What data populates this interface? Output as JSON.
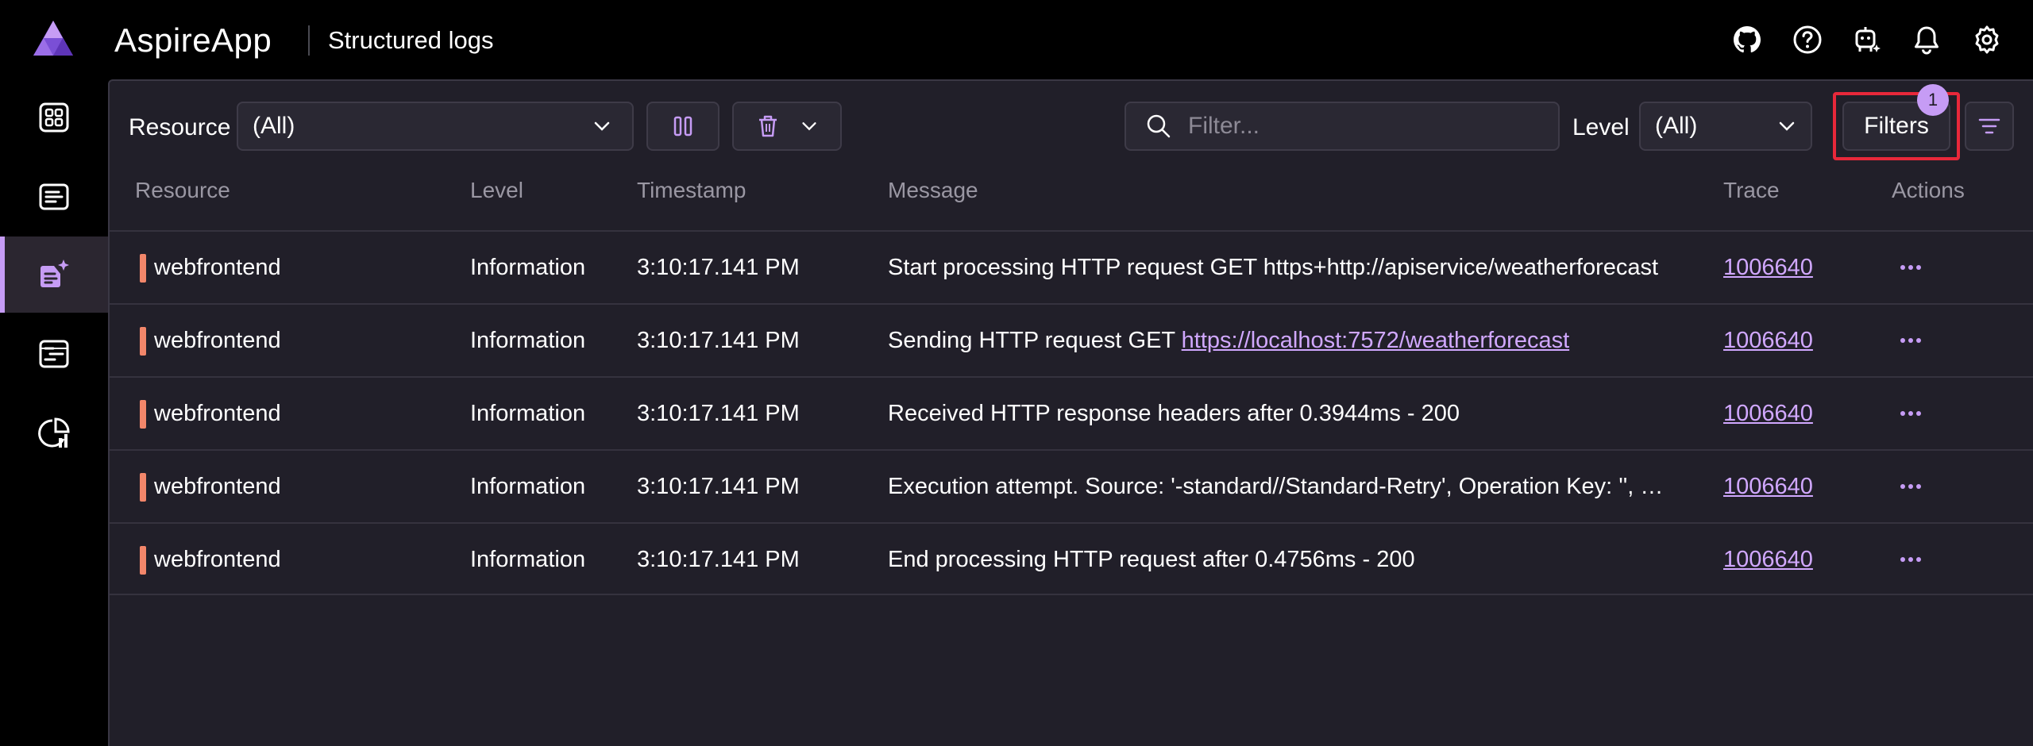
{
  "header": {
    "app_title": "AspireApp",
    "page_title": "Structured logs",
    "icons": [
      "github-icon",
      "help-icon",
      "copilot-icon",
      "notifications-icon",
      "settings-icon"
    ]
  },
  "sidenav": {
    "items": [
      {
        "name": "resources",
        "icon": "grid-icon",
        "active": false
      },
      {
        "name": "console",
        "icon": "console-icon",
        "active": false
      },
      {
        "name": "structured-logs",
        "icon": "structured-logs-icon",
        "active": true
      },
      {
        "name": "traces",
        "icon": "traces-icon",
        "active": false
      },
      {
        "name": "metrics",
        "icon": "metrics-icon",
        "active": false
      }
    ]
  },
  "toolbar": {
    "resource_label": "Resource",
    "resource_value": "(All)",
    "filter_placeholder": "Filter...",
    "level_label": "Level",
    "level_value": "(All)",
    "filters_label": "Filters",
    "filters_badge": "1"
  },
  "table": {
    "columns": [
      "Resource",
      "Level",
      "Timestamp",
      "Message",
      "Trace",
      "Actions"
    ],
    "rows": [
      {
        "resource": "webfrontend",
        "level": "Information",
        "timestamp": "3:10:17.141 PM",
        "message": "Start processing HTTP request GET https+http://apiservice/weatherforecast",
        "message_prefix": "",
        "message_link": "",
        "trace": "1006640"
      },
      {
        "resource": "webfrontend",
        "level": "Information",
        "timestamp": "3:10:17.141 PM",
        "message": "",
        "message_prefix": "Sending HTTP request GET ",
        "message_link": "https://localhost:7572/weatherforecast",
        "trace": "1006640"
      },
      {
        "resource": "webfrontend",
        "level": "Information",
        "timestamp": "3:10:17.141 PM",
        "message": "Received HTTP response headers after 0.3944ms - 200",
        "message_prefix": "",
        "message_link": "",
        "trace": "1006640"
      },
      {
        "resource": "webfrontend",
        "level": "Information",
        "timestamp": "3:10:17.141 PM",
        "message": "Execution attempt. Source: '-standard//Standard-Retry', Operation Key: '', Re...",
        "message_prefix": "",
        "message_link": "",
        "trace": "1006640"
      },
      {
        "resource": "webfrontend",
        "level": "Information",
        "timestamp": "3:10:17.141 PM",
        "message": "End processing HTTP request after 0.4756ms - 200",
        "message_prefix": "",
        "message_link": "",
        "trace": "1006640"
      }
    ]
  },
  "colors": {
    "accent": "#c69cf5",
    "resource_marker": "#f2866a",
    "highlight": "#e8283a",
    "link": "#d1a8ff"
  }
}
